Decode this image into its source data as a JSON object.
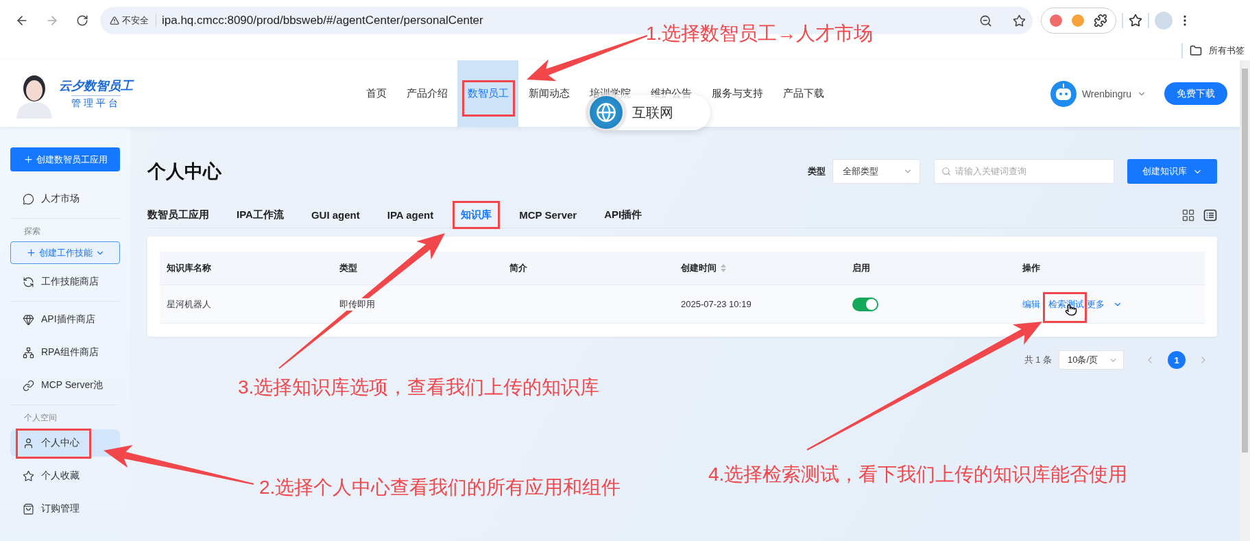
{
  "browser": {
    "security": "不安全",
    "url": "ipa.hq.cmcc:8090/prod/bbsweb/#/agentCenter/personalCenter",
    "bookmarks": "所有书签"
  },
  "header": {
    "logo_title": "云夕数智员工",
    "logo_subtitle": "管理平台",
    "user": "Wrenbingru",
    "download": "免费下载",
    "nav": [
      {
        "label": "首页",
        "selected": false,
        "highlighted": false
      },
      {
        "label": "产品介绍",
        "selected": false,
        "highlighted": false
      },
      {
        "label": "数智员工",
        "selected": true,
        "highlighted": true
      },
      {
        "label": "新闻动态",
        "selected": false,
        "highlighted": false
      },
      {
        "label": "培训学院",
        "selected": false,
        "highlighted": false
      },
      {
        "label": "维护公告",
        "selected": false,
        "highlighted": false
      },
      {
        "label": "服务与支持",
        "selected": false,
        "highlighted": false
      },
      {
        "label": "产品下载",
        "selected": false,
        "highlighted": false
      }
    ]
  },
  "overlay_badge": {
    "label": "互联网"
  },
  "sidebar": [
    {
      "kind": "primary",
      "label": "创建数智员工应用"
    },
    {
      "kind": "item",
      "label": "人才市场",
      "selected": false,
      "highlighted": false
    },
    {
      "kind": "divider"
    },
    {
      "kind": "section",
      "label": "探索"
    },
    {
      "kind": "dropdown",
      "label": "创建工作技能"
    },
    {
      "kind": "item",
      "label": "工作技能商店",
      "selected": false,
      "highlighted": false
    },
    {
      "kind": "divider"
    },
    {
      "kind": "item",
      "label": "API插件商店",
      "selected": false,
      "highlighted": false
    },
    {
      "kind": "item",
      "label": "RPA组件商店",
      "selected": false,
      "highlighted": false
    },
    {
      "kind": "item",
      "label": "MCP Server池",
      "selected": false,
      "highlighted": false
    },
    {
      "kind": "divider"
    },
    {
      "kind": "section",
      "label": "个人空间"
    },
    {
      "kind": "item",
      "label": "个人中心",
      "selected": true,
      "highlighted": true
    },
    {
      "kind": "item",
      "label": "个人收藏",
      "selected": false,
      "highlighted": false
    },
    {
      "kind": "item",
      "label": "订购管理",
      "selected": false,
      "highlighted": false
    }
  ],
  "page": {
    "title": "个人中心",
    "filter_label": "类型",
    "type_select": "全部类型",
    "search_placeholder": "请输入关键词查询",
    "create_button": "创建知识库"
  },
  "tabs": [
    {
      "label": "数智员工应用",
      "selected": false,
      "highlighted": false
    },
    {
      "label": "IPA工作流",
      "selected": false,
      "highlighted": false
    },
    {
      "label": "GUI agent",
      "selected": false,
      "highlighted": false
    },
    {
      "label": "IPA agent",
      "selected": false,
      "highlighted": false
    },
    {
      "label": "知识库",
      "selected": true,
      "highlighted": true
    },
    {
      "label": "MCP Server",
      "selected": false,
      "highlighted": false
    },
    {
      "label": "API插件",
      "selected": false,
      "highlighted": false
    }
  ],
  "table": {
    "columns": [
      {
        "label": "知识库名称",
        "sortable": false
      },
      {
        "label": "类型",
        "sortable": false
      },
      {
        "label": "简介",
        "sortable": false
      },
      {
        "label": "创建时间",
        "sortable": true
      },
      {
        "label": "启用",
        "sortable": false
      },
      {
        "label": "操作",
        "sortable": false
      }
    ],
    "rows": [
      {
        "name": "星河机器人",
        "type": "即传即用",
        "created": "2025-07-23 10:19",
        "enabled": true,
        "actions": [
          {
            "label": "编辑",
            "highlighted": false,
            "pointer": false
          },
          {
            "label": "检索测试",
            "highlighted": true,
            "pointer": true
          },
          {
            "label": "更多",
            "highlighted": false,
            "pointer": false
          }
        ]
      }
    ]
  },
  "pagination": {
    "total": "共 1 条",
    "page_size": "10条/页",
    "pages": [
      {
        "label": "1",
        "selected": true
      }
    ]
  },
  "annotations": [
    {
      "text": "1.选择数智员工→人才市场"
    },
    {
      "text": "3.选择知识库选项，查看我们上传的知识库"
    },
    {
      "text": "2.选择个人中心查看我们的所有应用和组件"
    },
    {
      "text": "4.选择检索测试，看下我们上传的知识库能否使用"
    }
  ]
}
